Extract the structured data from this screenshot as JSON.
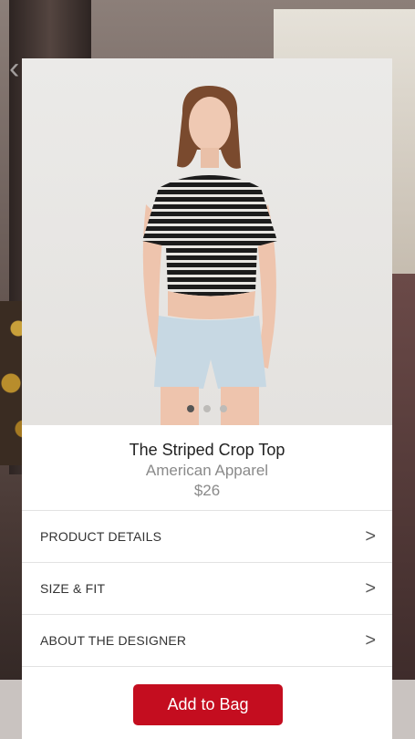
{
  "product": {
    "title": "The Striped Crop Top",
    "brand": "American Apparel",
    "price": "$26",
    "image_count": 3,
    "active_image": 1
  },
  "sections": [
    {
      "label": "PRODUCT DETAILS",
      "chevron": ">"
    },
    {
      "label": "SIZE & FIT",
      "chevron": ">"
    },
    {
      "label": "ABOUT THE DESIGNER",
      "chevron": ">"
    }
  ],
  "cta": {
    "label": "Add to Bag"
  },
  "colors": {
    "accent": "#c40d1f",
    "text": "#222222",
    "muted": "#8a8a8a"
  }
}
